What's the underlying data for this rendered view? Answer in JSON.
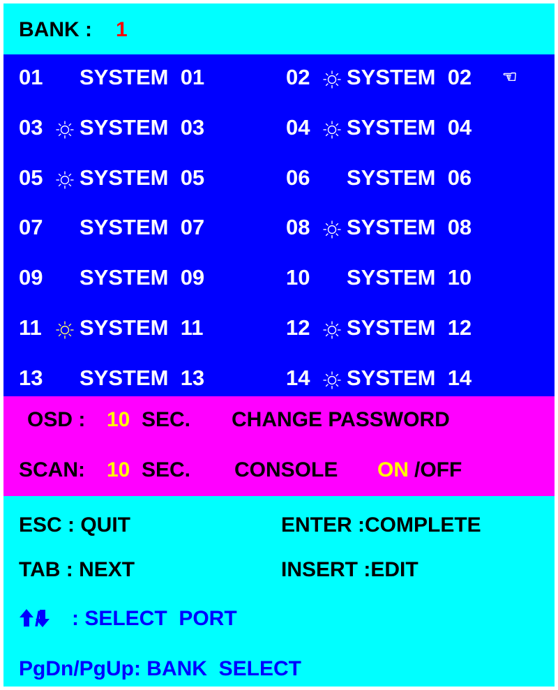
{
  "header": {
    "bank_label": "BANK :",
    "bank_number": "1"
  },
  "ports": [
    {
      "num": "01",
      "name": "SYSTEM  01",
      "active": false,
      "selected": false
    },
    {
      "num": "02",
      "name": "SYSTEM  02",
      "active": true,
      "selected": true
    },
    {
      "num": "03",
      "name": "SYSTEM  03",
      "active": true,
      "selected": false
    },
    {
      "num": "04",
      "name": "SYSTEM  04",
      "active": true,
      "selected": false
    },
    {
      "num": "05",
      "name": "SYSTEM  05",
      "active": true,
      "selected": false
    },
    {
      "num": "06",
      "name": "SYSTEM  06",
      "active": false,
      "selected": false
    },
    {
      "num": "07",
      "name": "SYSTEM  07",
      "active": false,
      "selected": false
    },
    {
      "num": "08",
      "name": "SYSTEM  08",
      "active": true,
      "selected": false
    },
    {
      "num": "09",
      "name": "SYSTEM  09",
      "active": false,
      "selected": false
    },
    {
      "num": "10",
      "name": "SYSTEM  10",
      "active": false,
      "selected": false
    },
    {
      "num": "11",
      "name": "SYSTEM  11",
      "active": true,
      "selected": false
    },
    {
      "num": "12",
      "name": "SYSTEM  12",
      "active": true,
      "selected": false
    },
    {
      "num": "13",
      "name": "SYSTEM  13",
      "active": false,
      "selected": false
    },
    {
      "num": "14",
      "name": "SYSTEM  14",
      "active": true,
      "selected": false
    }
  ],
  "settings": {
    "osd_label": "OSD :",
    "osd_value": "10",
    "osd_unit": "SEC.",
    "change_password": "CHANGE PASSWORD",
    "scan_label": "SCAN:",
    "scan_value": "10",
    "scan_unit": "SEC.",
    "console_label": "CONSOLE",
    "console_on": "ON",
    "console_off": "/OFF"
  },
  "help": {
    "esc": "ESC : QUIT",
    "enter": "ENTER :COMPLETE",
    "tab": "TAB : NEXT",
    "insert": "INSERT :EDIT",
    "arrows": ": SELECT  PORT",
    "pages": "PgDn/PgUp: BANK  SELECT"
  },
  "icons": {
    "active_port": "sun-icon",
    "selected_port": "pointing-hand-icon",
    "up": "up-arrow-icon",
    "down": "down-arrow-icon"
  },
  "colors": {
    "header_bg": "#00ffff",
    "ports_bg": "#0000ff",
    "settings_bg": "#ff00ff",
    "help_bg": "#00ffff",
    "highlight": "#ffff00",
    "bank_number": "#ff0000"
  }
}
